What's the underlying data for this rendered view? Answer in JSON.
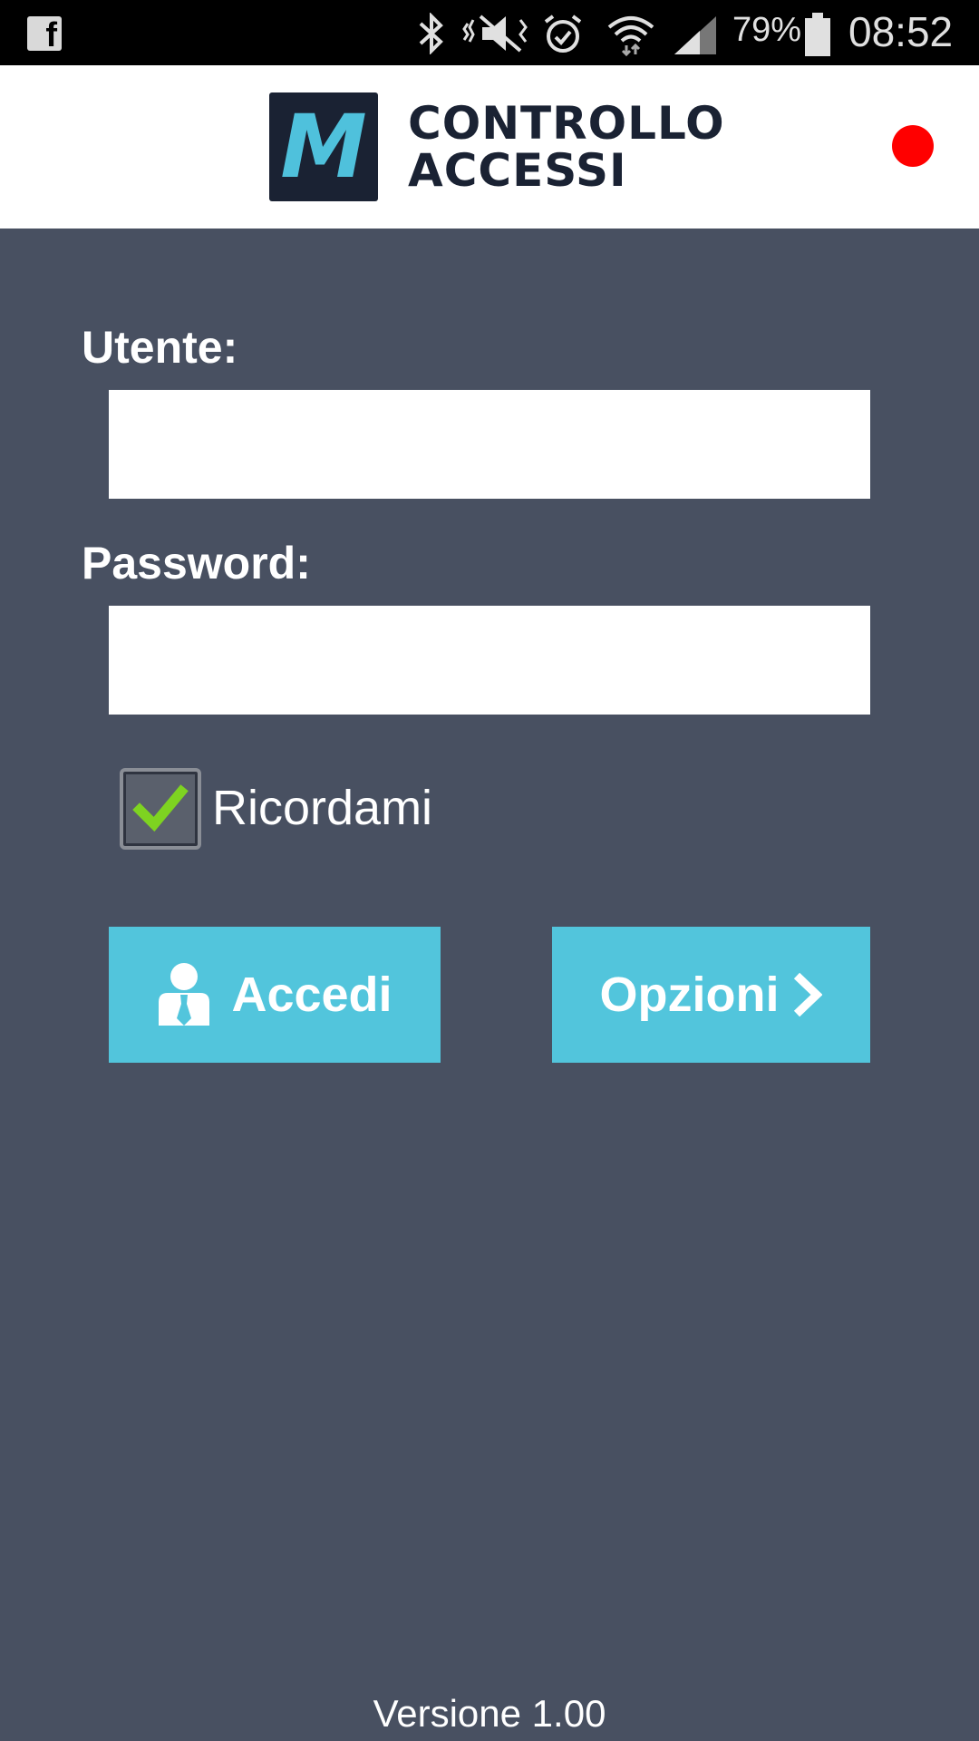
{
  "status_bar": {
    "battery": "79%",
    "time": "08:52"
  },
  "header": {
    "logo_letter": "M",
    "logo_line1": "CONTROLLO",
    "logo_line2": "ACCESSI"
  },
  "form": {
    "user_label": "Utente:",
    "user_value": "",
    "password_label": "Password:",
    "password_value": "",
    "remember_label": "Ricordami",
    "remember_checked": true
  },
  "buttons": {
    "login_label": "Accedi",
    "options_label": "Opzioni"
  },
  "footer": {
    "version": "Versione 1.00"
  },
  "colors": {
    "background": "#485061",
    "accent": "#52c5dc",
    "status_dot": "#ff0000",
    "checkmark": "#7ed321"
  }
}
